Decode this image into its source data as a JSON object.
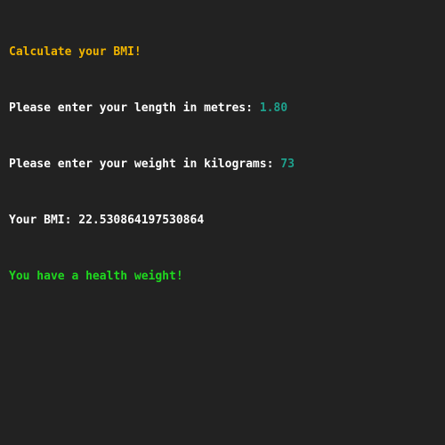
{
  "colors": {
    "background": "#222222",
    "title": "#f0b400",
    "prompt": "#ffffff",
    "input": "#1ea08c",
    "success": "#1fd81f"
  },
  "terminal": {
    "title": "Calculate your BMI!",
    "length_prompt": "Please enter your length in metres: ",
    "length_value": "1.80",
    "weight_prompt": "Please enter your weight in kilograms: ",
    "weight_value": "73",
    "bmi_label": "Your BMI: ",
    "bmi_value": "22.530864197530864",
    "result_message": "You have a health weight!"
  }
}
